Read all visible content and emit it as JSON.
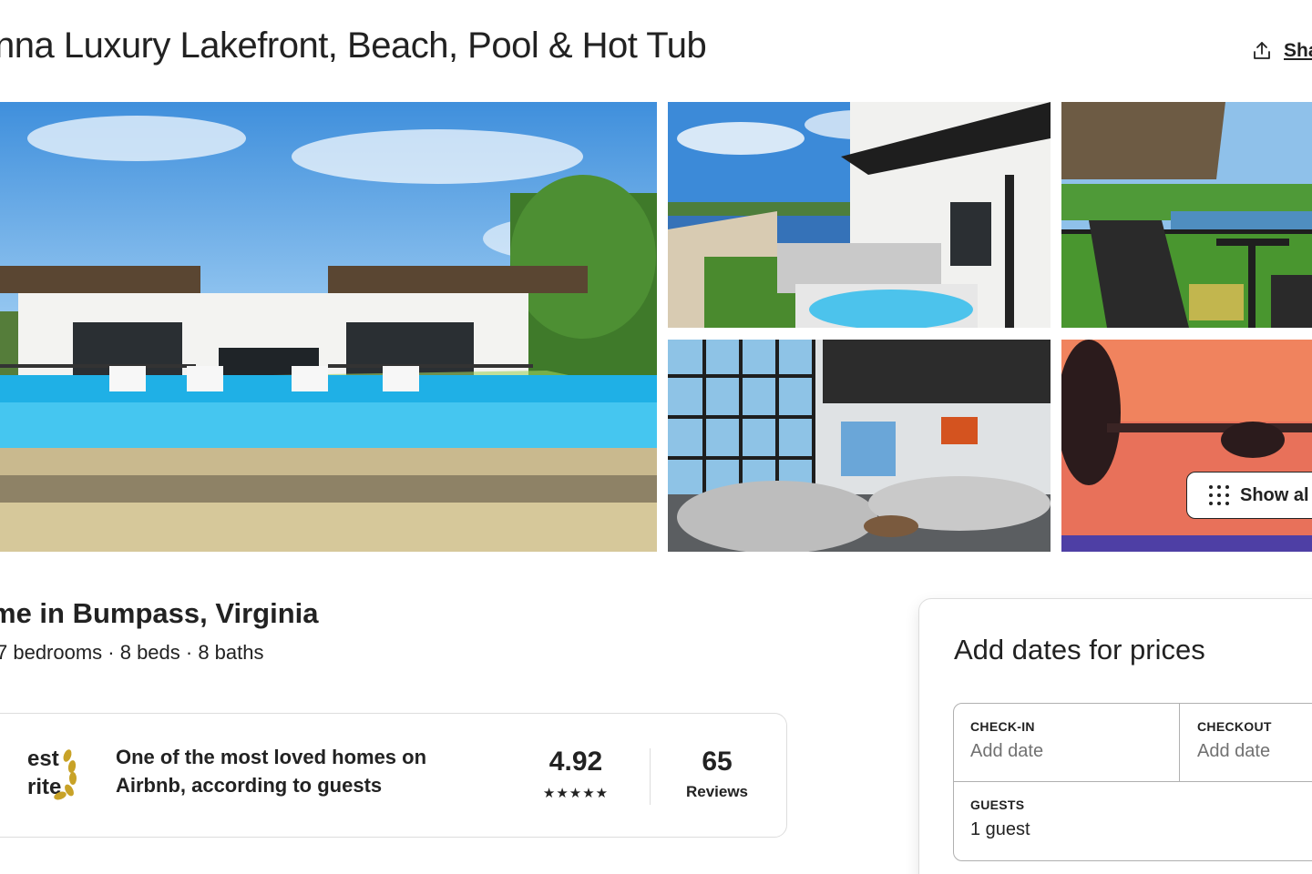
{
  "listing": {
    "title": "nna Luxury Lakefront, Beach, Pool & Hot Tub",
    "share_label": "Sha",
    "subtitle": "me in Bumpass, Virginia",
    "details": "7 bedrooms · 8 beds · 8 baths",
    "show_all_label": "Show al"
  },
  "guest_favorite": {
    "label_line1": "est",
    "label_line2": "rite",
    "description": "One of the most loved homes on Airbnb, according to guests",
    "rating": "4.92",
    "stars": "★★★★★",
    "reviews_count": "65",
    "reviews_label": "Reviews"
  },
  "booking": {
    "heading": "Add dates for prices",
    "checkin_label": "CHECK-IN",
    "checkin_value": "Add date",
    "checkout_label": "CHECKOUT",
    "checkout_value": "Add date",
    "guests_label": "GUESTS",
    "guests_value": "1 guest"
  },
  "colors": {
    "text": "#222222",
    "muted": "#717171",
    "border": "#dddddd",
    "pool": "#2bb6e8",
    "sky": "#4aa3e8"
  },
  "icons": {
    "share": "share-icon",
    "grid": "grid-dots-icon",
    "laurel": "laurel-icon"
  }
}
